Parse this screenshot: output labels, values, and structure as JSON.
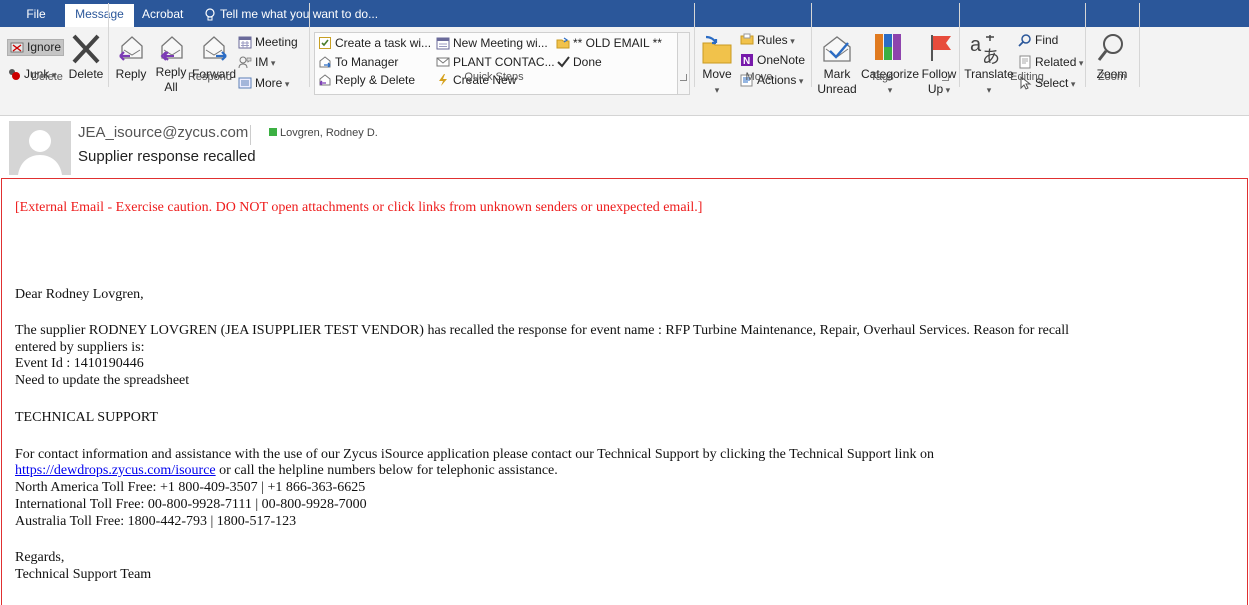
{
  "tabs": {
    "file": "File",
    "message": "Message",
    "acrobat": "Acrobat",
    "tell_me": "Tell me what you want to do..."
  },
  "ribbon": {
    "delete_group": {
      "ignore": "Ignore",
      "junk": "Junk",
      "delete": "Delete",
      "label": "Delete"
    },
    "respond_group": {
      "reply": "Reply",
      "reply_all_1": "Reply",
      "reply_all_2": "All",
      "forward": "Forward",
      "meeting": "Meeting",
      "im": "IM",
      "more": "More",
      "label": "Respond"
    },
    "quick_steps": {
      "items": [
        "Create a task wi...",
        "To Manager",
        "Reply & Delete",
        "New Meeting wi...",
        "PLANT CONTAC...",
        "Create New",
        "** OLD EMAIL **",
        "Done"
      ],
      "label": "Quick Steps"
    },
    "move_group": {
      "move": "Move",
      "rules": "Rules",
      "onenote": "OneNote",
      "actions": "Actions",
      "label": "Move"
    },
    "tags_group": {
      "mark_1": "Mark",
      "mark_2": "Unread",
      "categorize": "Categorize",
      "follow_1": "Follow",
      "follow_2": "Up",
      "label": "Tags"
    },
    "editing_group": {
      "translate": "Translate",
      "find": "Find",
      "related": "Related",
      "select": "Select",
      "label": "Editing"
    },
    "zoom_group": {
      "zoom": "Zoom",
      "label": "Zoom"
    }
  },
  "header": {
    "sender": "JEA_isource@zycus.com",
    "recipient": "Lovgren, Rodney D.",
    "subject": "Supplier response recalled"
  },
  "body": {
    "external_warning": "[External Email - Exercise caution. DO NOT open attachments or click links from unknown senders or unexpected email.]",
    "greeting": "Dear Rodney Lovgren,",
    "para1_line1": "The supplier RODNEY LOVGREN (JEA ISUPPLIER TEST VENDOR) has recalled the response for event name : RFP Turbine Maintenance, Repair, Overhaul Services. Reason for recall",
    "para1_line2": "entered by suppliers is:",
    "event_id": "Event Id : 1410190446",
    "reason": "Need to update the spreadsheet",
    "tech_heading": "TECHNICAL SUPPORT",
    "tech_line1": "For contact information and assistance with the use of our Zycus iSource application please contact our Technical Support by clicking the Technical Support link on",
    "tech_link": "https://dewdrops.zycus.com/isource",
    "tech_line2_rest": " or call the helpline numbers below for telephonic assistance.",
    "na_phone": "North America Toll Free: +1 800-409-3507 | +1 866-363-6625",
    "intl_phone": "International Toll Free: 00-800-9928-7111 | 00-800-9928-7000",
    "au_phone": "Australia Toll Free: 1800-442-793 | 1800-517-123",
    "regards": "Regards,",
    "team": "Technical Support Team"
  },
  "colors": {
    "tab_bar": "#2b579a",
    "warning_red": "#ee1c1c",
    "link_blue": "#0000ee",
    "body_border": "#e03030"
  }
}
